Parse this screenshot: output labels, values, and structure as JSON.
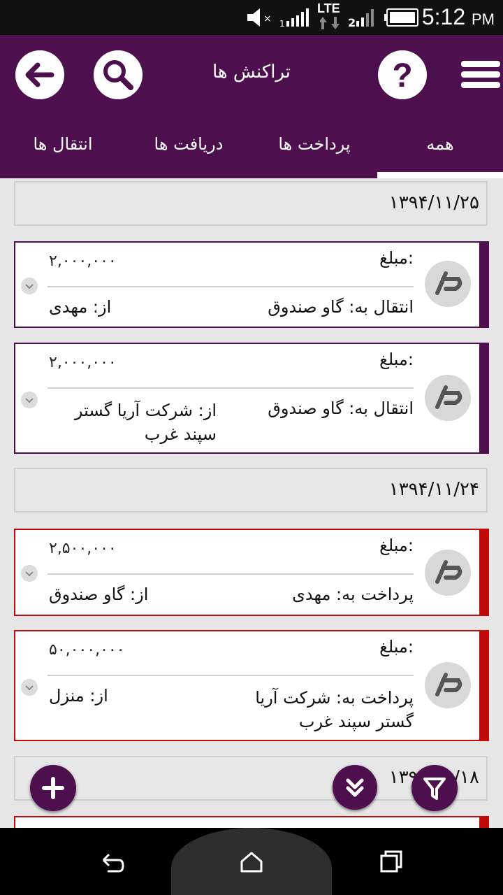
{
  "status_bar": {
    "time": "5:12",
    "ampm": "PM",
    "network1": "LTE",
    "network2": "2"
  },
  "header": {
    "title": "تراکنش ها"
  },
  "tabs": [
    {
      "label": "همه",
      "active": true
    },
    {
      "label": "پرداخت ها",
      "active": false
    },
    {
      "label": "دریافت ها",
      "active": false
    },
    {
      "label": "انتقال ها",
      "active": false
    }
  ],
  "groups": [
    {
      "date": "۱۳۹۴/۱۱/۲۵",
      "items": [
        {
          "amount_label": "مبلغ:",
          "amount": "۲,۰۰۰,۰۰۰",
          "to": "انتقال به: گاو صندوق",
          "from": "از: مهدی"
        },
        {
          "amount_label": "مبلغ:",
          "amount": "۲,۰۰۰,۰۰۰",
          "to": "انتقال به: گاو صندوق",
          "from": "از: شرکت آریا گستر سپند غرب"
        }
      ]
    },
    {
      "date": "۱۳۹۴/۱۱/۲۴",
      "items": [
        {
          "amount_label": "مبلغ:",
          "amount": "۲,۵۰۰,۰۰۰",
          "to": "پرداخت به: مهدی",
          "from": "از: گاو صندوق"
        },
        {
          "amount_label": "مبلغ:",
          "amount": "۵۰,۰۰۰,۰۰۰",
          "to": "پرداخت به: شرکت آریا گستر سپند غرب",
          "from": "از: منزل"
        }
      ]
    },
    {
      "date": "۱۳۹۴/۱۱/۱۸",
      "items": []
    }
  ],
  "colors": {
    "primary": "#4d0f4e",
    "payment": "#c20a0a",
    "transfer": "#4d0f4e"
  }
}
